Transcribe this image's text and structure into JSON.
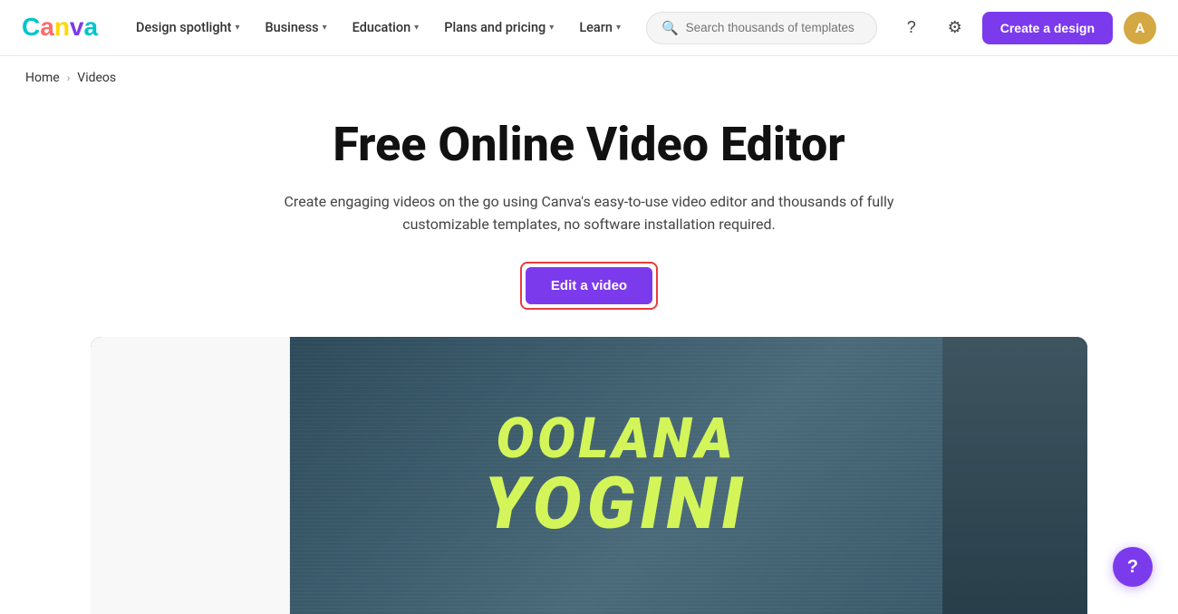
{
  "logo": {
    "text": "Canva"
  },
  "navbar": {
    "design_spotlight_label": "Design spotlight",
    "business_label": "Business",
    "education_label": "Education",
    "plans_pricing_label": "Plans and pricing",
    "learn_label": "Learn",
    "search_placeholder": "Search thousands of templates",
    "create_design_label": "Create a design",
    "avatar_initials": "A"
  },
  "breadcrumb": {
    "home_label": "Home",
    "separator": "›",
    "current_label": "Videos"
  },
  "hero": {
    "title": "Free Online Video Editor",
    "description": "Create engaging videos on the go using Canva's easy-to-use video editor and thousands of fully customizable templates, no software installation required.",
    "edit_video_label": "Edit a video"
  },
  "video_preview": {
    "title_top": "OOLANA",
    "title_bottom": "YOGINI"
  },
  "help": {
    "label": "?"
  }
}
